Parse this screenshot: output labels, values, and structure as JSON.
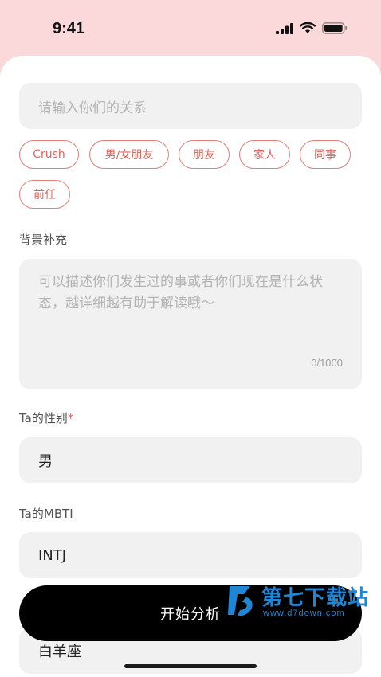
{
  "status_bar": {
    "time": "9:41"
  },
  "relation": {
    "placeholder": "请输入你们的关系",
    "chips": [
      "Crush",
      "男/女朋友",
      "朋友",
      "家人",
      "同事",
      "前任"
    ]
  },
  "background": {
    "label": "背景补充",
    "placeholder": "可以描述你们发生过的事或者你们现在是什么状态，越详细越有助于解读哦～",
    "counter": "0/1000"
  },
  "gender": {
    "label": "Ta的性别",
    "required_mark": "*",
    "value": "男"
  },
  "mbti": {
    "label": "Ta的MBTI",
    "value": "INTJ"
  },
  "zodiac": {
    "value": "白羊座"
  },
  "start_button": {
    "label": "开始分析"
  },
  "watermark": {
    "title": "第七下载站",
    "url": "www.d7down.com"
  },
  "colors": {
    "background_pink": "#FBD9DB",
    "chip_accent": "#E57F76",
    "button": "#000000"
  }
}
